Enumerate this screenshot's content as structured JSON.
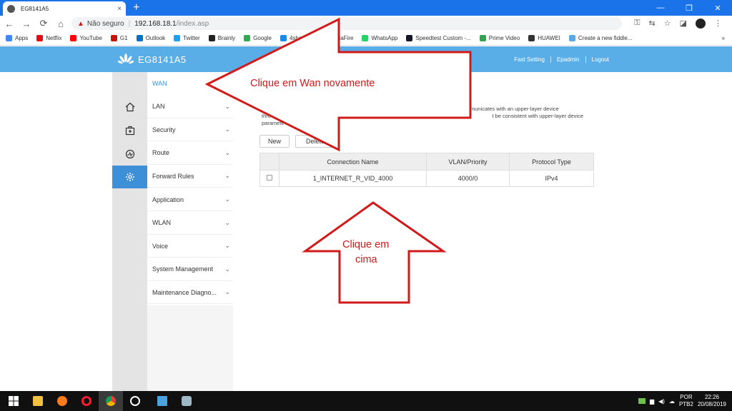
{
  "browser": {
    "tab_title": "EG8141A5",
    "tab_close": "×",
    "new_tab": "+",
    "window_controls": [
      "—",
      "❐",
      "✕"
    ],
    "nav": {
      "back": "←",
      "forward": "→",
      "reload": "⟳",
      "home": "⌂"
    },
    "address": {
      "warning_icon": "▲",
      "security_label": "Não seguro",
      "separator": "|",
      "host": "192.168.18.1",
      "path": "/index.asp"
    },
    "toolbar_icons": [
      "⚿",
      "⇆",
      "☆",
      "◪"
    ],
    "menu_icon": "⋮"
  },
  "bookmarks": [
    {
      "label": "Apps",
      "color": "#4285f4"
    },
    {
      "label": "Netflix",
      "color": "#e50914"
    },
    {
      "label": "YouTube",
      "color": "#ff0000"
    },
    {
      "label": "G1",
      "color": "#c4170c"
    },
    {
      "label": "Outlook",
      "color": "#0072c6"
    },
    {
      "label": "Twitter",
      "color": "#1da1f2"
    },
    {
      "label": "Brainly",
      "color": "#222222"
    },
    {
      "label": "Google",
      "color": "#34a853"
    },
    {
      "label": "4shared",
      "color": "#1e88e5"
    },
    {
      "label": "MediaFire",
      "color": "#1299f3"
    },
    {
      "label": "WhatsApp",
      "color": "#25d366"
    },
    {
      "label": "Speedtest Custom -...",
      "color": "#141526"
    },
    {
      "label": "Prime Video",
      "color": "#2ea44f"
    },
    {
      "label": "HUAWEI",
      "color": "#333333"
    },
    {
      "label": "Create a new fiddle...",
      "color": "#5aa9e6"
    }
  ],
  "bookmarks_more": "»",
  "router": {
    "model": "EG8141A5",
    "header_links": [
      "Fast Setting",
      "Epadmin",
      "Logout"
    ],
    "menu": [
      {
        "label": "WAN",
        "active": true
      },
      {
        "label": "LAN"
      },
      {
        "label": "Security"
      },
      {
        "label": "Route"
      },
      {
        "label": "Forward Rules"
      },
      {
        "label": "Application"
      },
      {
        "label": "WLAN"
      },
      {
        "label": "Voice"
      },
      {
        "label": "System Management"
      },
      {
        "label": "Maintenance Diagno..."
      }
    ],
    "left_icons": [
      "home-icon",
      "toolbox-icon",
      "gauge-icon",
      "gear-icon"
    ],
    "description_line1": "municates with an upper-layer device",
    "description_line2_a": "thro",
    "description_line2_b": "t be consistent with upper-layer device",
    "description_line3": "paramete",
    "buttons": {
      "new": "New",
      "delete": "Delete"
    },
    "table": {
      "headers": [
        "",
        "Connection Name",
        "VLAN/Priority",
        "Protocol Type"
      ],
      "rows": [
        [
          "",
          "1_INTERNET_R_VID_4000",
          "4000/0",
          "IPv4"
        ]
      ]
    }
  },
  "annotations": {
    "arrow_left_text": "Clique em Wan novamente",
    "arrow_up_text_line1": "Clique em",
    "arrow_up_text_line2": "cima",
    "color": "#d11a1a"
  },
  "taskbar": {
    "apps": [
      "windows-start-icon",
      "file-explorer-icon",
      "firefox-icon",
      "opera-icon",
      "chrome-icon",
      "settings-icon",
      "remote-desktop-icon",
      "app-icon"
    ],
    "lang_top": "POR",
    "lang_bottom": "PTB2",
    "time": "22:26",
    "date": "20/08/2019"
  }
}
